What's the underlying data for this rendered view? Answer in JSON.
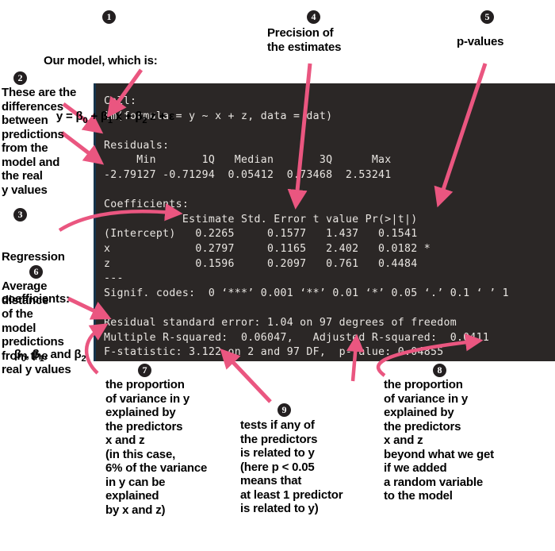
{
  "console": {
    "text": "Call:\nlm(formula = y ~ x + z, data = dat)\n\nResiduals:\n     Min       1Q   Median       3Q      Max\n-2.79127 -0.71294  0.05412  0.73468  2.53241\n\nCoefficients:\n            Estimate Std. Error t value Pr(>|t|)\n(Intercept)   0.2265     0.1577   1.437   0.1541\nx             0.2797     0.1165   2.402   0.0182 *\nz             0.1596     0.2097   0.761   0.4484\n---\nSignif. codes:  0 ‘***’ 0.001 ‘**’ 0.01 ‘*’ 0.05 ‘.’ 0.1 ‘ ’ 1\n\nResidual standard error: 1.04 on 97 degrees of freedom\nMultiple R-squared:  0.06047,\tAdjusted R-squared:  0.0411\nF-statistic: 3.122 on 2 and 97 DF,  p-value: 0.04855",
    "background_color": "#2b2726",
    "text_color": "#e9e6e2",
    "border_color": "#16344b"
  },
  "model_output": {
    "call": "lm(formula = y ~ x + z, data = dat)",
    "residuals": {
      "headers": [
        "Min",
        "1Q",
        "Median",
        "3Q",
        "Max"
      ],
      "values": [
        "-2.79127",
        "-0.71294",
        "0.05412",
        "0.73468",
        "2.53241"
      ]
    },
    "coefficients": {
      "headers": [
        "",
        "Estimate",
        "Std. Error",
        "t value",
        "Pr(>|t|)",
        ""
      ],
      "rows": [
        [
          "(Intercept)",
          "0.2265",
          "0.1577",
          "1.437",
          "0.1541",
          ""
        ],
        [
          "x",
          "0.2797",
          "0.1165",
          "2.402",
          "0.0182",
          "*"
        ],
        [
          "z",
          "0.1596",
          "0.2097",
          "0.761",
          "0.4484",
          ""
        ]
      ]
    },
    "signif_codes": "0 ‘***’ 0.001 ‘**’ 0.01 ‘*’ 0.05 ‘.’ 0.1 ‘ ’ 1",
    "residual_standard_error": "1.04",
    "degrees_of_freedom": "97",
    "multiple_r_squared": "0.06047",
    "adjusted_r_squared": "0.0411",
    "f_statistic": "3.122",
    "f_df1": "2",
    "f_df2": "97",
    "p_value": "0.04855"
  },
  "annotations": {
    "a1": {
      "number": "1",
      "line1": "Our model, which is:",
      "line2_parts": [
        "y = β",
        "0",
        " + β",
        "1",
        " x + β",
        "2",
        " z + ε"
      ]
    },
    "a2": {
      "number": "2",
      "text": "These are the\ndifferences\nbetween\npredictions\nfrom the\nmodel and\nthe real\ny values"
    },
    "a3": {
      "number": "3",
      "line1": "Regression",
      "line2": "coefficients:",
      "line3_parts": [
        "β",
        "0",
        ", β",
        "1",
        ", and β",
        "2"
      ]
    },
    "a4": {
      "number": "4",
      "text": "Precision of\nthe estimates"
    },
    "a5": {
      "number": "5",
      "text": "p-values"
    },
    "a6": {
      "number": "6",
      "text": "Average\ndistance\nof the\nmodel\npredictions\nfrom the\nreal y values"
    },
    "a7": {
      "number": "7",
      "text": "the proportion\nof variance in y\nexplained by\nthe predictors\nx and z\n(in this case,\n6% of the variance\nin y can be\nexplained\nby x and z)"
    },
    "a8": {
      "number": "8",
      "text": "the proportion\nof variance in y\nexplained by\nthe predictors\nx and z\nbeyond what we get\nif we added\na random variable\nto the model"
    },
    "a9": {
      "number": "9",
      "text": "tests if any of\nthe predictors\nis related to y\n(here p < 0.05\nmeans that\nat least 1 predictor\nis related to y)"
    }
  },
  "colors": {
    "arrow": "#ea5680",
    "text": "#000000",
    "badge_bg": "#231f20",
    "page_bg": "#ffffff"
  }
}
